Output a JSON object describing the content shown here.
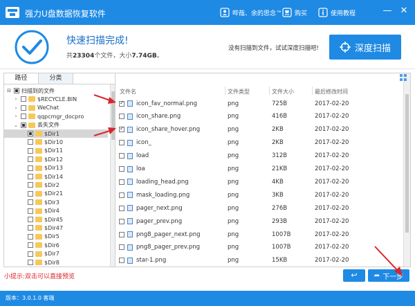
{
  "titlebar": {
    "app_title": "强力U盘数据恢复软件",
    "user_label": "哔哉、余的思念™",
    "buy_label": "购买",
    "tutorial_label": "使用教程",
    "minimize_glyph": "—",
    "close_glyph": "✕"
  },
  "header": {
    "scan_title": "快速扫描完成!",
    "summary_prefix": "共",
    "file_count": "23304",
    "summary_mid": "个文件，大小",
    "total_size": "7.74GB",
    "summary_suffix": "。",
    "no_file_text": "没有扫描到文件，试试深度扫描吧!",
    "deep_scan_label": "深度扫描"
  },
  "left_panel": {
    "tabs": [
      {
        "label": "路径"
      },
      {
        "label": "分类"
      }
    ],
    "tree": [
      {
        "label": "扫描到的文件",
        "expander": "⊟",
        "indent": 0,
        "check": "partial",
        "folder": false
      },
      {
        "label": "$RECYCLE.BIN",
        "expander": "›",
        "indent": 1,
        "check": "none",
        "folder": true
      },
      {
        "label": "WeChat",
        "expander": "›",
        "indent": 1,
        "check": "none",
        "folder": true
      },
      {
        "label": "qqpcmgr_docpro",
        "expander": "›",
        "indent": 1,
        "check": "none",
        "folder": true
      },
      {
        "label": "丢失文件",
        "expander": "⌄",
        "indent": 1,
        "check": "partial",
        "folder": true
      },
      {
        "label": "$Dir1",
        "expander": "",
        "indent": 2,
        "check": "partial",
        "folder": true,
        "selected": true
      },
      {
        "label": "$Dir10",
        "expander": "",
        "indent": 2,
        "check": "none",
        "folder": true
      },
      {
        "label": "$Dir11",
        "expander": "",
        "indent": 2,
        "check": "none",
        "folder": true
      },
      {
        "label": "$Dir12",
        "expander": "",
        "indent": 2,
        "check": "none",
        "folder": true
      },
      {
        "label": "$Dir13",
        "expander": "",
        "indent": 2,
        "check": "none",
        "folder": true
      },
      {
        "label": "$Dir14",
        "expander": "",
        "indent": 2,
        "check": "none",
        "folder": true
      },
      {
        "label": "$Dir2",
        "expander": "",
        "indent": 2,
        "check": "none",
        "folder": true
      },
      {
        "label": "$Dir21",
        "expander": "",
        "indent": 2,
        "check": "none",
        "folder": true
      },
      {
        "label": "$Dir3",
        "expander": "",
        "indent": 2,
        "check": "none",
        "folder": true
      },
      {
        "label": "$Dir4",
        "expander": "",
        "indent": 2,
        "check": "none",
        "folder": true
      },
      {
        "label": "$Dir45",
        "expander": "",
        "indent": 2,
        "check": "none",
        "folder": true
      },
      {
        "label": "$Dir47",
        "expander": "",
        "indent": 2,
        "check": "none",
        "folder": true
      },
      {
        "label": "$Dir5",
        "expander": "",
        "indent": 2,
        "check": "none",
        "folder": true
      },
      {
        "label": "$Dir6",
        "expander": "",
        "indent": 2,
        "check": "none",
        "folder": true
      },
      {
        "label": "$Dir7",
        "expander": "",
        "indent": 2,
        "check": "none",
        "folder": true
      },
      {
        "label": "$Dir8",
        "expander": "",
        "indent": 2,
        "check": "none",
        "folder": true
      }
    ]
  },
  "file_list": {
    "columns": {
      "name": "文件名",
      "type": "文件类型",
      "size": "文件大小",
      "date": "最后修改时间"
    },
    "rows": [
      {
        "name": "icon_fav_normal.png",
        "type": "png",
        "size": "725B",
        "date": "2017-02-20",
        "checked": true
      },
      {
        "name": "icon_share.png",
        "type": "png",
        "size": "416B",
        "date": "2017-02-20",
        "checked": false
      },
      {
        "name": "icon_share_hover.png",
        "type": "png",
        "size": "2KB",
        "date": "2017-02-20",
        "checked": true
      },
      {
        "name": "icon_",
        "type": "png",
        "size": "2KB",
        "date": "2017-02-20",
        "checked": false
      },
      {
        "name": "load",
        "type": "png",
        "size": "312B",
        "date": "2017-02-20",
        "checked": false
      },
      {
        "name": "loa",
        "type": "png",
        "size": "21KB",
        "date": "2017-02-20",
        "checked": false
      },
      {
        "name": "loading_head.png",
        "type": "png",
        "size": "4KB",
        "date": "2017-02-20",
        "checked": false
      },
      {
        "name": "mask_loading.png",
        "type": "png",
        "size": "3KB",
        "date": "2017-02-20",
        "checked": false
      },
      {
        "name": "pager_next.png",
        "type": "png",
        "size": "276B",
        "date": "2017-02-20",
        "checked": false
      },
      {
        "name": "pager_prev.png",
        "type": "png",
        "size": "293B",
        "date": "2017-02-20",
        "checked": false
      },
      {
        "name": "png8_pager_next.png",
        "type": "png",
        "size": "1007B",
        "date": "2017-02-20",
        "checked": false
      },
      {
        "name": "png8_pager_prev.png",
        "type": "png",
        "size": "1007B",
        "date": "2017-02-20",
        "checked": false
      },
      {
        "name": "star-1.png",
        "type": "png",
        "size": "15KB",
        "date": "2017-02-20",
        "checked": false
      }
    ]
  },
  "footer": {
    "hint": "小提示:双击可以直接预览",
    "back_glyph": "↩",
    "next_label": "下一步",
    "version_label": "版本：3.0.1.0 客端"
  },
  "colors": {
    "brand": "#1e8ae4",
    "accent_text": "#1a6fc9",
    "hint": "#d9262c",
    "arrow": "#d9262c"
  }
}
